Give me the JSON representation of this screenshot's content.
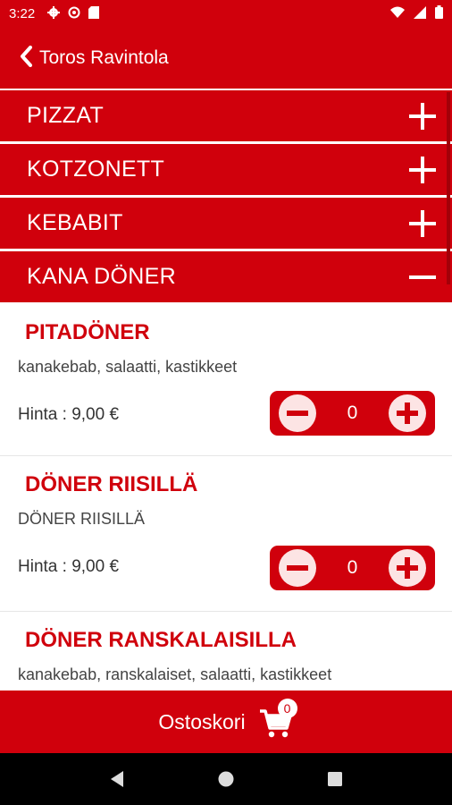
{
  "status_bar": {
    "time": "3:22",
    "icons": [
      "gear-icon",
      "sync-icon",
      "sd-card-icon",
      "wifi-icon",
      "signal-icon",
      "battery-icon"
    ]
  },
  "app_bar": {
    "back_icon": "chevron-left-icon",
    "title": "Toros Ravintola"
  },
  "categories": [
    {
      "label": "PIZZAT",
      "state": "collapsed"
    },
    {
      "label": "KOTZONETT",
      "state": "collapsed"
    },
    {
      "label": "KEBABIT",
      "state": "collapsed"
    },
    {
      "label": "KANA DÖNER",
      "state": "expanded"
    }
  ],
  "items": [
    {
      "name": "PITADÖNER",
      "description": "kanakebab, salaatti, kastikkeet",
      "price": "Hinta : 9,00 €",
      "quantity": "0"
    },
    {
      "name": "DÖNER RIISILLÄ",
      "description": "DÖNER RIISILLÄ",
      "price": "Hinta : 9,00 €",
      "quantity": "0"
    },
    {
      "name": "DÖNER RANSKALAISILLA",
      "description": "kanakebab, ranskalaiset, salaatti, kastikkeet"
    }
  ],
  "cart": {
    "label": "Ostoskori",
    "count": "0",
    "icon": "shopping-cart-icon"
  },
  "nav": {
    "icons": [
      "back-triangle-icon",
      "home-circle-icon",
      "recents-square-icon"
    ]
  },
  "colors": {
    "brand": "#d0000c",
    "stepper_button": "#fce4e4"
  }
}
